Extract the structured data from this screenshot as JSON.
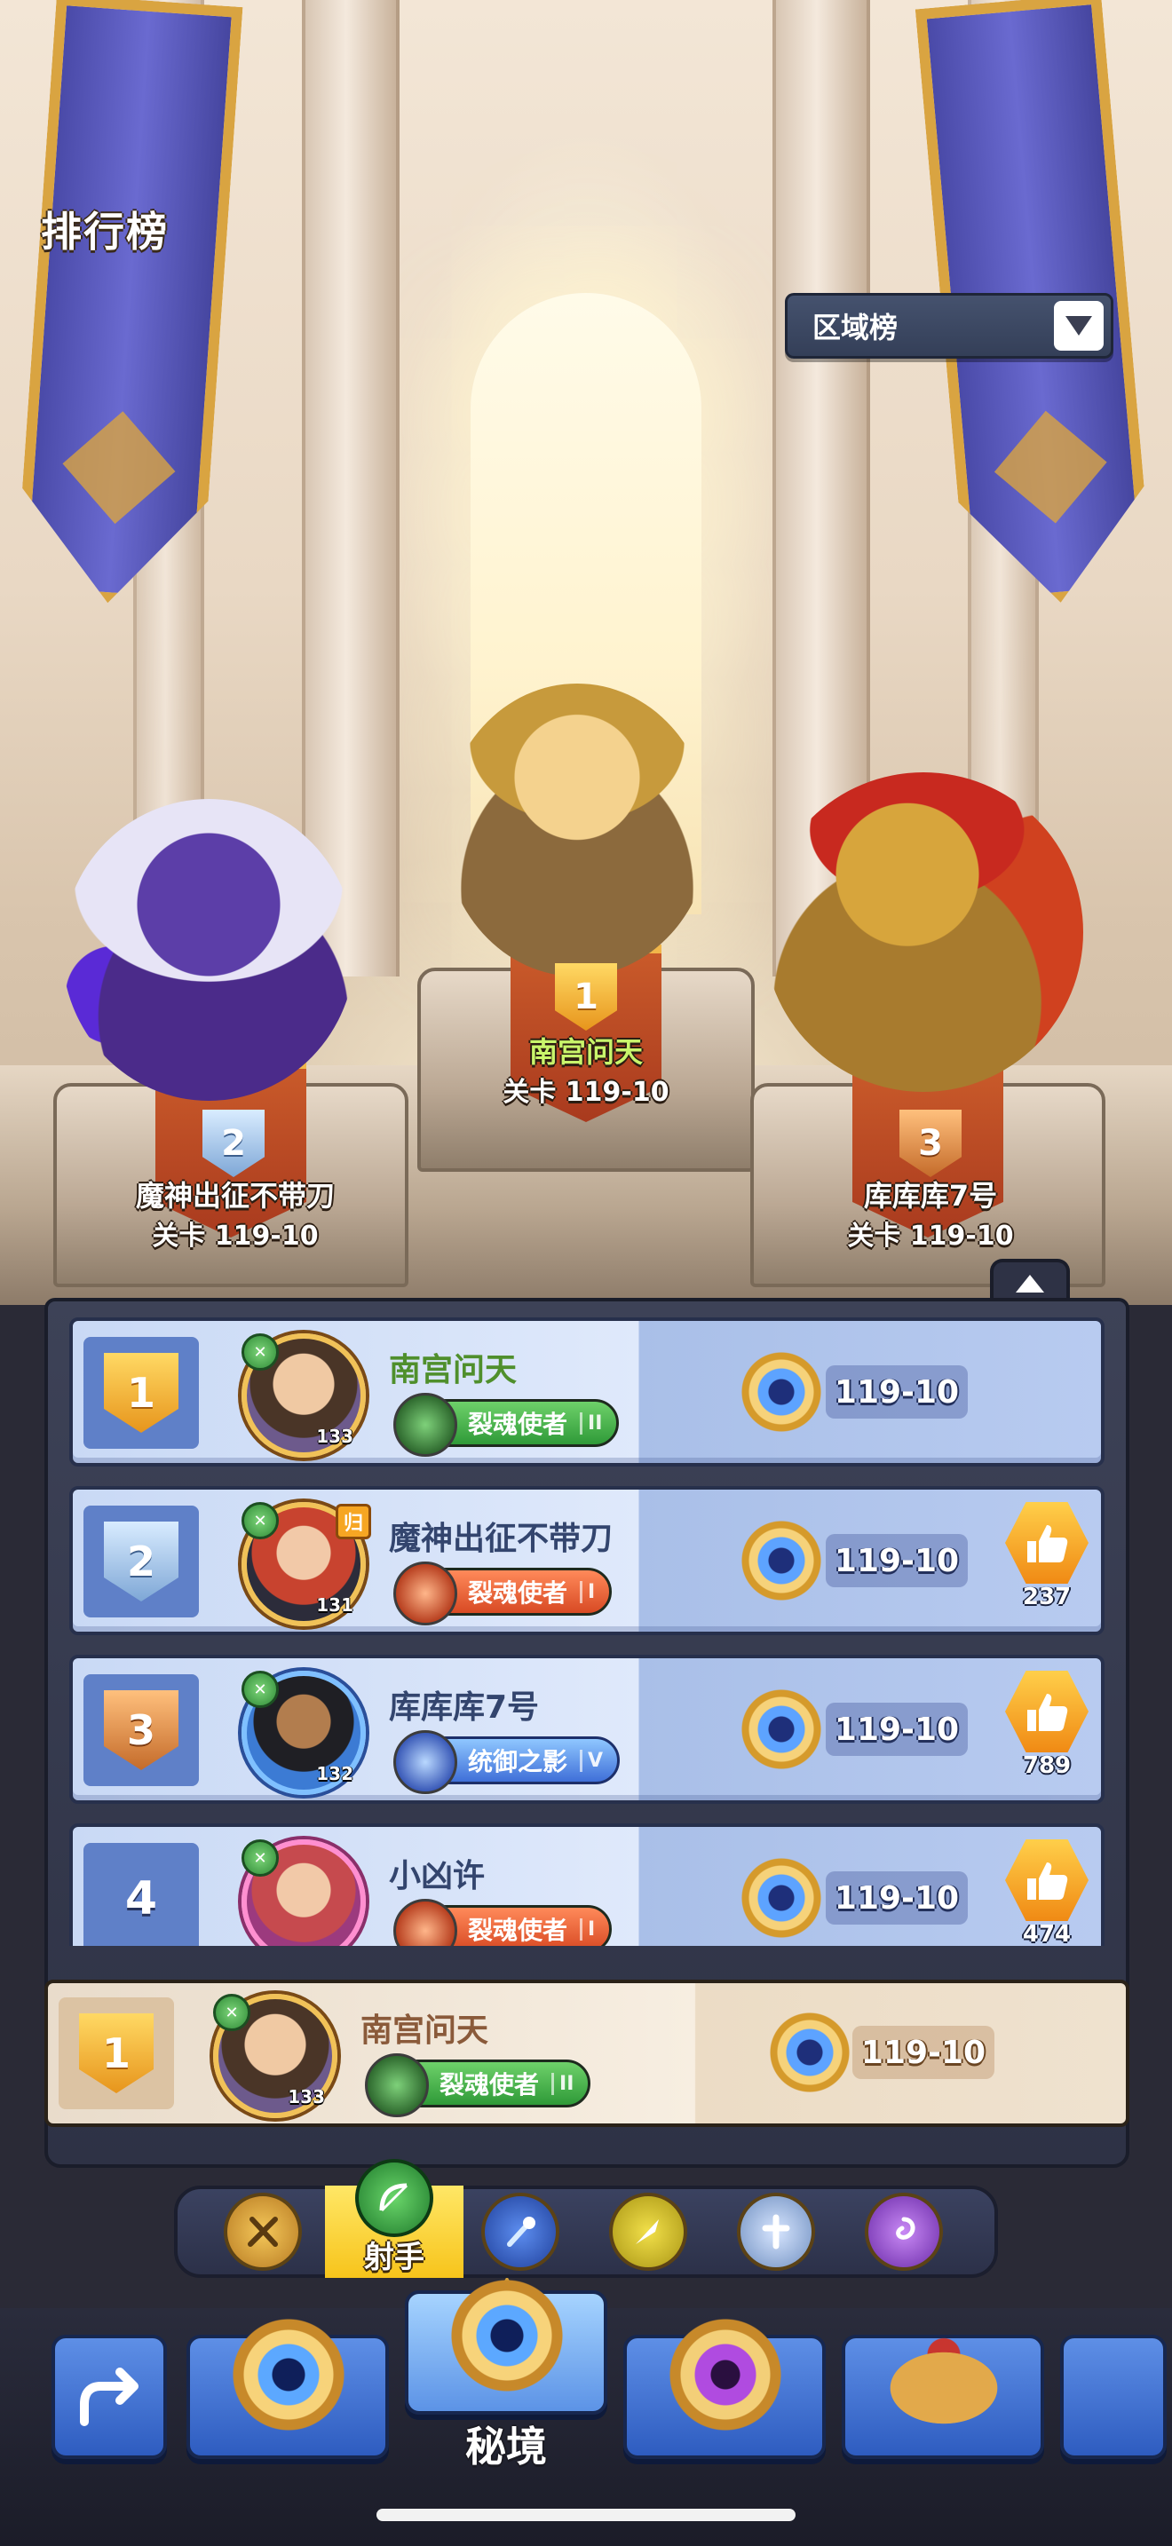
{
  "header": {
    "title": "排行榜",
    "region_select": "区域榜"
  },
  "podium": [
    {
      "rank": "1",
      "name": "南宫问天",
      "stage": "关卡 119-10"
    },
    {
      "rank": "2",
      "name": "魔神出征不带刀",
      "stage": "关卡 119-10"
    },
    {
      "rank": "3",
      "name": "库库库7号",
      "stage": "关卡 119-10"
    }
  ],
  "rankings": [
    {
      "rank": "1",
      "name": "南宫问天",
      "level": "133",
      "title": "裂魂使者",
      "title_tier": "II",
      "stage": "119-10",
      "likes": null
    },
    {
      "rank": "2",
      "name": "魔神出征不带刀",
      "level": "131",
      "title": "裂魂使者",
      "title_tier": "I",
      "stage": "119-10",
      "likes": "237",
      "badge": "归"
    },
    {
      "rank": "3",
      "name": "库库库7号",
      "level": "132",
      "title": "统御之影",
      "title_tier": "V",
      "stage": "119-10",
      "likes": "789"
    },
    {
      "rank": "4",
      "name": "小凶许",
      "level": "",
      "title": "裂魂使者",
      "title_tier": "I",
      "stage": "119-10",
      "likes": "474"
    }
  ],
  "my_rank": {
    "rank": "1",
    "name": "南宫问天",
    "level": "133",
    "title": "裂魂使者",
    "title_tier": "II",
    "stage": "119-10"
  },
  "class_filter": {
    "selected_label": "射手",
    "classes": [
      "warrior-icon",
      "archer-icon",
      "mage-icon",
      "assassin-icon",
      "priest-icon",
      "summoner-icon"
    ]
  },
  "bottom_nav": {
    "active_label": "秘境",
    "items": [
      "back-icon",
      "stage-medal-icon",
      "secret-realm-icon",
      "purple-medal-icon",
      "crown-icon",
      "more-icon"
    ]
  },
  "colors": {
    "gold": "#e7951c",
    "silver": "#7ea7d6",
    "bronze": "#c46b2a",
    "panel": "#2e3245",
    "row_blue": "#c9d9f5"
  }
}
